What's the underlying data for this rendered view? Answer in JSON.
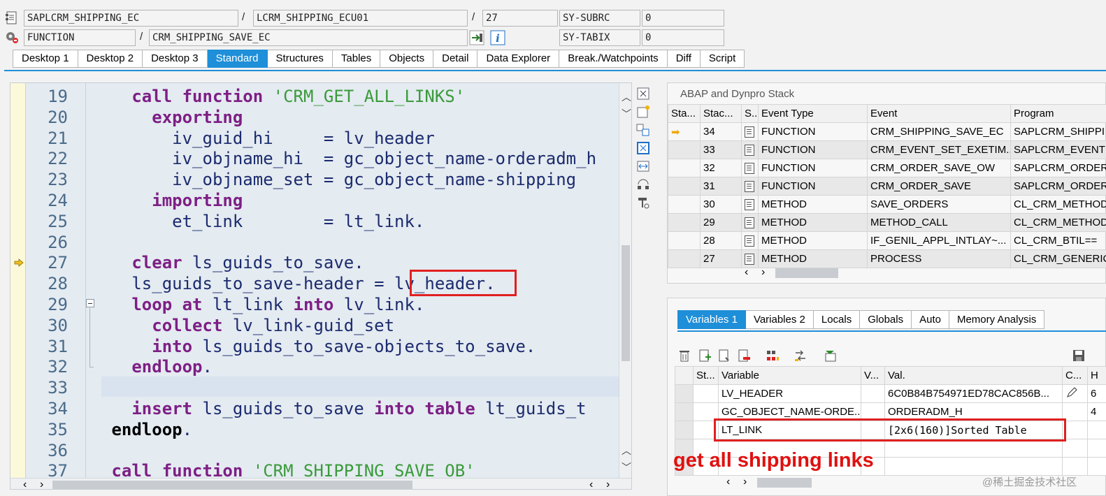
{
  "header": {
    "program": "SAPLCRM_SHIPPING_EC",
    "include": "LCRM_SHIPPING_ECU01",
    "line": "27",
    "sy_subrc_label": "SY-SUBRC",
    "sy_subrc_value": "0",
    "event_type": "FUNCTION",
    "event": "CRM_SHIPPING_SAVE_EC",
    "sy_tabix_label": "SY-TABIX",
    "sy_tabix_value": "0",
    "sep1": "/",
    "sep2": "/",
    "sep3": "/"
  },
  "tabs": [
    "Desktop 1",
    "Desktop 2",
    "Desktop 3",
    "Standard",
    "Structures",
    "Tables",
    "Objects",
    "Detail",
    "Data Explorer",
    "Break./Watchpoints",
    "Diff",
    "Script"
  ],
  "active_tab": "Standard",
  "editor": {
    "lines": [
      {
        "no": "19",
        "code": [
          [
            "   ",
            ""
          ],
          [
            "call function",
            "kw"
          ],
          [
            " ",
            ""
          ],
          [
            "'CRM_GET_ALL_LINKS'",
            "str"
          ]
        ]
      },
      {
        "no": "20",
        "code": [
          [
            "     ",
            ""
          ],
          [
            "exporting",
            "kw"
          ]
        ]
      },
      {
        "no": "21",
        "code": [
          [
            "       iv_guid_hi     = lv_header",
            ""
          ]
        ]
      },
      {
        "no": "22",
        "code": [
          [
            "       iv_objname_hi  = gc_object_name-orderadm_h",
            ""
          ]
        ]
      },
      {
        "no": "23",
        "code": [
          [
            "       iv_objname_set = gc_object_name-shipping",
            ""
          ]
        ]
      },
      {
        "no": "24",
        "code": [
          [
            "     ",
            ""
          ],
          [
            "importing",
            "kw"
          ]
        ]
      },
      {
        "no": "25",
        "code": [
          [
            "       et_link        = lt_link.",
            ""
          ]
        ]
      },
      {
        "no": "26",
        "code": []
      },
      {
        "no": "27",
        "code": [
          [
            "   ",
            ""
          ],
          [
            "clear",
            "kw"
          ],
          [
            " ls_guids_to_save.",
            ""
          ]
        ]
      },
      {
        "no": "28",
        "code": [
          [
            "   ls_guids_to_save-header = lv_header.",
            ""
          ]
        ]
      },
      {
        "no": "29",
        "code": [
          [
            "   ",
            ""
          ],
          [
            "loop at",
            "kw"
          ],
          [
            " lt_link ",
            ""
          ],
          [
            "into",
            "kw"
          ],
          [
            " lv_link.",
            ""
          ]
        ]
      },
      {
        "no": "30",
        "code": [
          [
            "     ",
            ""
          ],
          [
            "collect",
            "kw"
          ],
          [
            " lv_link-guid_set",
            ""
          ]
        ]
      },
      {
        "no": "31",
        "code": [
          [
            "     ",
            ""
          ],
          [
            "into",
            "kw"
          ],
          [
            " ls_guids_to_save-objects_to_save.",
            ""
          ]
        ]
      },
      {
        "no": "32",
        "code": [
          [
            "   ",
            ""
          ],
          [
            "endloop",
            "kw"
          ],
          [
            ".",
            ""
          ]
        ]
      },
      {
        "no": "33",
        "code": []
      },
      {
        "no": "34",
        "code": [
          [
            "   ",
            ""
          ],
          [
            "insert",
            "kw"
          ],
          [
            " ls_guids_to_save ",
            ""
          ],
          [
            "into",
            "kw"
          ],
          [
            " ",
            ""
          ],
          [
            "table",
            "kw"
          ],
          [
            " lt_guids_t",
            ""
          ]
        ]
      },
      {
        "no": "35",
        "code": [
          [
            " ",
            ""
          ],
          [
            "endloop",
            "plain-b"
          ],
          [
            ".",
            ""
          ]
        ]
      },
      {
        "no": "36",
        "code": []
      },
      {
        "no": "37",
        "code": [
          [
            " ",
            ""
          ],
          [
            "call function",
            "kw"
          ],
          [
            " ",
            ""
          ],
          [
            "'CRM_SHIPPING_SAVE_OB'",
            "str"
          ]
        ]
      }
    ]
  },
  "stack": {
    "title": "ABAP and Dynpro Stack",
    "columns": [
      "Sta...",
      "Stac...",
      "S..",
      "Event Type",
      "Event",
      "Program"
    ],
    "rows": [
      {
        "level": "34",
        "type": "FUNCTION",
        "event": "CRM_SHIPPING_SAVE_EC",
        "program": "SAPLCRM_SHIPPI",
        "current": true
      },
      {
        "level": "33",
        "type": "FUNCTION",
        "event": "CRM_EVENT_SET_EXETIM...",
        "program": "SAPLCRM_EVENT"
      },
      {
        "level": "32",
        "type": "FUNCTION",
        "event": "CRM_ORDER_SAVE_OW",
        "program": "SAPLCRM_ORDER"
      },
      {
        "level": "31",
        "type": "FUNCTION",
        "event": "CRM_ORDER_SAVE",
        "program": "SAPLCRM_ORDER"
      },
      {
        "level": "30",
        "type": "METHOD",
        "event": "SAVE_ORDERS",
        "program": "CL_CRM_METHOD"
      },
      {
        "level": "29",
        "type": "METHOD",
        "event": "METHOD_CALL",
        "program": "CL_CRM_METHOD"
      },
      {
        "level": "28",
        "type": "METHOD",
        "event": "IF_GENIL_APPL_INTLAY~...",
        "program": "CL_CRM_BTIL=="
      },
      {
        "level": "27",
        "type": "METHOD",
        "event": "PROCESS",
        "program": "CL_CRM_GENERIC"
      }
    ]
  },
  "var_tabs": [
    "Variables 1",
    "Variables 2",
    "Locals",
    "Globals",
    "Auto",
    "Memory Analysis"
  ],
  "active_var_tab": "Variables 1",
  "variables": {
    "columns": [
      "St...",
      "Variable",
      "V...",
      "Val.",
      "C...",
      "H"
    ],
    "rows": [
      {
        "name": "LV_HEADER",
        "value": "6C0B84B754971ED78CAC856B...",
        "h": "6"
      },
      {
        "name": "GC_OBJECT_NAME-ORDE...",
        "value": "ORDERADM_H",
        "h": "4"
      },
      {
        "name": "LT_LINK",
        "value": "[2x6(160)]Sorted Table",
        "h": ""
      },
      {
        "name": "",
        "value": "",
        "h": ""
      },
      {
        "name": "",
        "value": "",
        "h": ""
      }
    ]
  },
  "annotation": "get all shipping links",
  "watermark": "@稀土掘金技术社区",
  "icons": {
    "up": "▲",
    "down": "▼",
    "left": "‹",
    "right": "›",
    "arrow": "➡"
  },
  "colors": {
    "accent": "#1e8fd8",
    "keyword": "#7d1f85",
    "string": "#3b9a3b",
    "annotation": "#e01010"
  }
}
